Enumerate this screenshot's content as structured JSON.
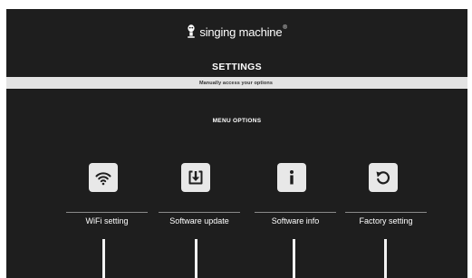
{
  "brand": {
    "name": "singing machine",
    "mark": "®"
  },
  "header": {
    "title": "SETTINGS",
    "subtitle": "Manually access your options"
  },
  "menu": {
    "heading": "MENU OPTIONS",
    "options": [
      {
        "label": "WiFi setting",
        "icon": "wifi-icon"
      },
      {
        "label": "Software update",
        "icon": "download-icon"
      },
      {
        "label": "Software info",
        "icon": "info-icon"
      },
      {
        "label": "Factory setting",
        "icon": "reset-icon"
      }
    ]
  },
  "colors": {
    "background": "#1e1e1e",
    "subtitle_bar": "#e3e3e3",
    "icon_tile": "#e8e8e8",
    "text": "#ffffff"
  }
}
